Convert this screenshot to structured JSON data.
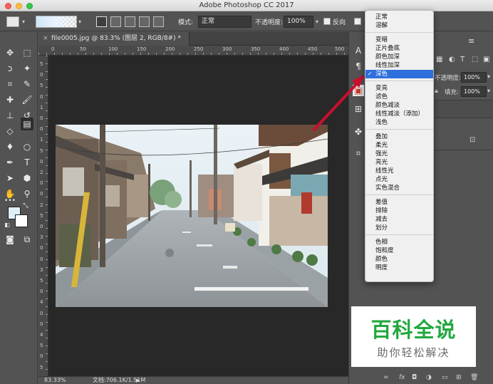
{
  "window": {
    "title": "Adobe Photoshop CC 2017"
  },
  "options_bar": {
    "mode_label": "模式:",
    "mode_value": "正常",
    "opacity_label": "不透明度:",
    "opacity_value": "100%",
    "reverse_label": "反向"
  },
  "document": {
    "tab_title": "file0005.jpg @ 83.3% (图层 2, RGB/8#) *",
    "close_glyph": "×",
    "ruler_h_numbers": [
      "0",
      "50",
      "100",
      "150",
      "200",
      "250",
      "300",
      "350",
      "400",
      "450",
      "500"
    ],
    "ruler_v_numbers": [
      "5",
      "0",
      "5",
      "0",
      "1",
      "0",
      "0",
      "1",
      "5",
      "0",
      "2",
      "0",
      "0",
      "2",
      "5",
      "0",
      "3",
      "0",
      "0",
      "3",
      "5",
      "0",
      "4",
      "0",
      "0",
      "4",
      "5",
      "0",
      "5"
    ]
  },
  "status": {
    "zoom": "83.33%",
    "doc_info": "文档:706.1K/1.51M"
  },
  "layers_panel": {
    "opacity_label": "不透明度:",
    "opacity_value": "100%",
    "fill_label": "填充:",
    "fill_value": "100%",
    "lock_icon": "lock-icon"
  },
  "blend_menu": {
    "groups": [
      [
        "正常",
        "溶解"
      ],
      [
        "变暗",
        "正片叠底",
        "颜色加深",
        "线性加深",
        "深色"
      ],
      [
        "变亮",
        "滤色",
        "颜色减淡",
        "线性减淡（添加）",
        "浅色"
      ],
      [
        "叠加",
        "柔光",
        "强光",
        "亮光",
        "线性光",
        "点光",
        "实色混合"
      ],
      [
        "差值",
        "排除",
        "减去",
        "划分"
      ],
      [
        "色相",
        "饱和度",
        "颜色",
        "明度"
      ]
    ],
    "selected": "深色",
    "check_glyph": "✓"
  },
  "watermark": {
    "title": "百科全说",
    "subtitle": "助你轻松解决"
  },
  "colors": {
    "menu_highlight": "#2f6fdc",
    "arrow": "#c8102e",
    "watermark_green": "#23a83f"
  }
}
